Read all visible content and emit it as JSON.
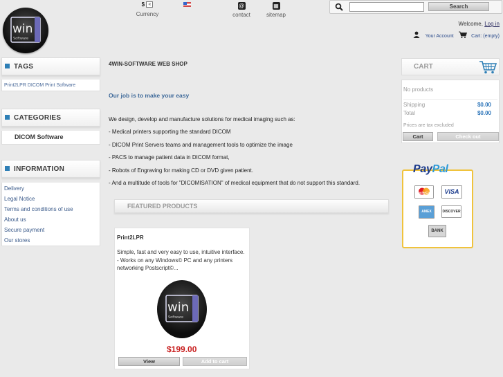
{
  "header": {
    "currency_label": "Currency",
    "currency_symbol": "$",
    "currency_toggle": "«",
    "contact_label": "contact",
    "sitemap_label": "sitemap",
    "search_placeholder": "",
    "search_button": "Search",
    "welcome_text": "Welcome,",
    "login_link": "Log in",
    "your_account": "Your Account",
    "cart_summary": "Cart: (empty)",
    "logo_text": "win",
    "logo_subtext": "Software"
  },
  "left": {
    "tags_title": "TAGS",
    "tags_text": "Print2LPR DICOM Print Software",
    "categories_title": "CATEGORIES",
    "categories": [
      "DICOM Software"
    ],
    "information_title": "INFORMATION",
    "information_links": [
      "Delivery",
      "Legal Notice",
      "Terms and conditions of use",
      "About us",
      "Secure payment",
      "Our stores"
    ]
  },
  "main": {
    "shop_title": "4WIN-SOFTWARE WEB SHOP",
    "lead": "Our job is to make your easy",
    "intro": "We design, develop and manufacture solutions for medical imaging such as:",
    "bullets": [
      "- Medical printers supporting the standard DICOM",
      "- DICOM Print Servers teams and management tools to optimize the image",
      "- PACS to manage patient data in DICOM format,",
      "- Robots of Engraving for making CD or DVD given patient.",
      "- And a multitude of tools for \"DICOMISATION\" of medical equipment that do not support this standard."
    ],
    "featured_title": "FEATURED PRODUCTS",
    "product": {
      "name": "Print2LPR",
      "desc_1": "Simple, fast and very easy to use, intuitive interface.",
      "desc_2": "- Works on any Windows© PC and any printers",
      "desc_3": "networking Postscript©...",
      "price": "$199.00",
      "view_label": "View",
      "add_label": "Add to cart"
    }
  },
  "cart": {
    "title": "CART",
    "no_products": "No products",
    "shipping_label": "Shipping",
    "shipping_value": "$0.00",
    "total_label": "Total",
    "total_value": "$0.00",
    "tax_note": "Prices are tax excluded",
    "cart_button": "Cart",
    "checkout_button": "Check out"
  },
  "payment": {
    "paypal_a": "Pay",
    "paypal_b": "Pal",
    "cards": [
      "MasterCard",
      "VISA",
      "AMEX",
      "DISCOVER",
      "BANK"
    ]
  },
  "colors": {
    "background": "#eaeaea",
    "accent_blue": "#2e7fb6",
    "price_red": "#c81d1d",
    "paypal_border": "#f0c33c"
  }
}
